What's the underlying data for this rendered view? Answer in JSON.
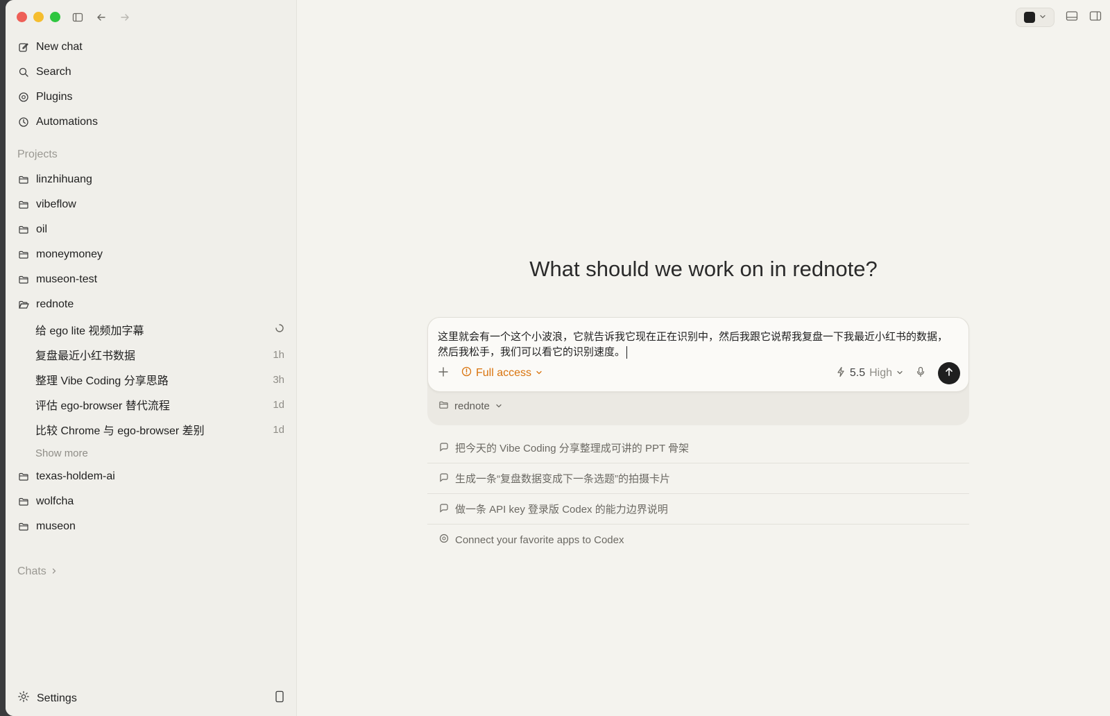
{
  "nav": [
    {
      "label": "New chat",
      "icon": "edit-icon"
    },
    {
      "label": "Search",
      "icon": "search-icon"
    },
    {
      "label": "Plugins",
      "icon": "plugin-icon"
    },
    {
      "label": "Automations",
      "icon": "clock-icon"
    }
  ],
  "sections": {
    "projects": "Projects",
    "chats": "Chats"
  },
  "projects": [
    {
      "label": "linzhihuang"
    },
    {
      "label": "vibeflow"
    },
    {
      "label": "oil"
    },
    {
      "label": "moneymoney"
    },
    {
      "label": "museon-test"
    },
    {
      "label": "rednote"
    }
  ],
  "threads": [
    {
      "label": "给 ego lite 视频加字幕",
      "time": ""
    },
    {
      "label": "复盘最近小红书数据",
      "time": "1h"
    },
    {
      "label": "整理 Vibe Coding 分享思路",
      "time": "3h"
    },
    {
      "label": "评估 ego-browser 替代流程",
      "time": "1d"
    },
    {
      "label": "比较 Chrome 与 ego-browser 差别",
      "time": "1d"
    }
  ],
  "show_more": "Show more",
  "projects_after": [
    {
      "label": "texas-holdem-ai"
    },
    {
      "label": "wolfcha"
    },
    {
      "label": "museon"
    }
  ],
  "settings": "Settings",
  "main": {
    "heading": "What should we work on in rednote?",
    "composer_text": "这里就会有一个这个小波浪，它就告诉我它现在正在识别中，然后我跟它说帮我复盘一下我最近小红书的数据，然后我松手，我们可以看它的识别速度。",
    "access": "Full access",
    "model": "5.5",
    "effort": "High",
    "project": "rednote",
    "suggestions": [
      "把今天的 Vibe Coding 分享整理成可讲的 PPT 骨架",
      "生成一条“复盘数据变成下一条选题”的拍摄卡片",
      "做一条 API key 登录版 Codex 的能力边界说明",
      "Connect your favorite apps to Codex"
    ]
  },
  "colors": {
    "accent_access": "#d9730d",
    "send_button": "#1f1f1f"
  }
}
